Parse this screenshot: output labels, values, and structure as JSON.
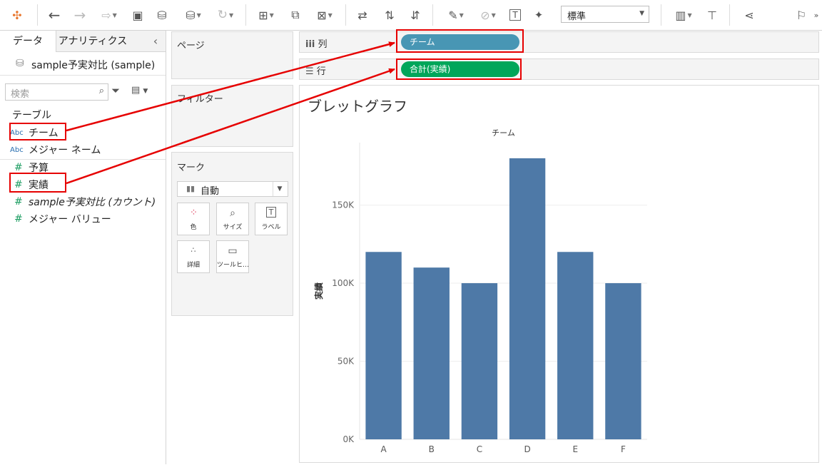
{
  "toolbar": {
    "format_select": "標準",
    "icons": [
      "tableau-logo-icon",
      "back-arrow-icon",
      "forward-arrow-icon",
      "redo-icon",
      "save-icon",
      "new-datasource-icon",
      "datasource-icon",
      "refresh-icon",
      "new-worksheet-icon",
      "duplicate-icon",
      "clear-icon",
      "swap-icon",
      "sort-asc-icon",
      "sort-desc-icon",
      "highlight-icon",
      "group-icon",
      "label-icon",
      "pin-icon",
      "show-me-icon",
      "presentation-icon",
      "share-icon",
      "sign-icon"
    ]
  },
  "datapane": {
    "tab_data": "データ",
    "tab_analytics": "アナリティクス",
    "collapse": "‹",
    "datasource": "sample予実対比 (sample)",
    "search_placeholder": "検索",
    "table_header": "テーブル",
    "fields": [
      {
        "type": "Abc",
        "name": "チーム"
      },
      {
        "type": "Abc",
        "name": "メジャー ネーム"
      },
      {
        "type": "#",
        "name": "予算"
      },
      {
        "type": "#",
        "name": "実績"
      },
      {
        "type": "#",
        "name": "sample予実対比 (カウント)"
      },
      {
        "type": "#",
        "name": "メジャー バリュー"
      }
    ]
  },
  "cards": {
    "pages": "ページ",
    "filters": "フィルター",
    "marks": "マーク",
    "mark_type": "自動",
    "buttons": [
      "色",
      "サイズ",
      "ラベル",
      "詳細",
      "ツールヒ…"
    ]
  },
  "shelves": {
    "columns_label": "列",
    "rows_label": "行",
    "columns_pill": "チーム",
    "rows_pill": "合計(実績)",
    "colors": {
      "dimension": "#4896b4",
      "measure": "#00a65a"
    }
  },
  "chart_data": {
    "type": "bar",
    "title": "ブレットグラフ",
    "xlabel": "チーム",
    "ylabel": "実績",
    "categories": [
      "A",
      "B",
      "C",
      "D",
      "E",
      "F"
    ],
    "values": [
      120000,
      110000,
      100000,
      180000,
      120000,
      100000
    ],
    "ylim": [
      0,
      190000
    ],
    "yticks": [
      0,
      50000,
      100000,
      150000
    ],
    "ytick_labels": [
      "0K",
      "50K",
      "100K",
      "150K"
    ],
    "grid": true,
    "bar_color": "#4e79a7"
  }
}
